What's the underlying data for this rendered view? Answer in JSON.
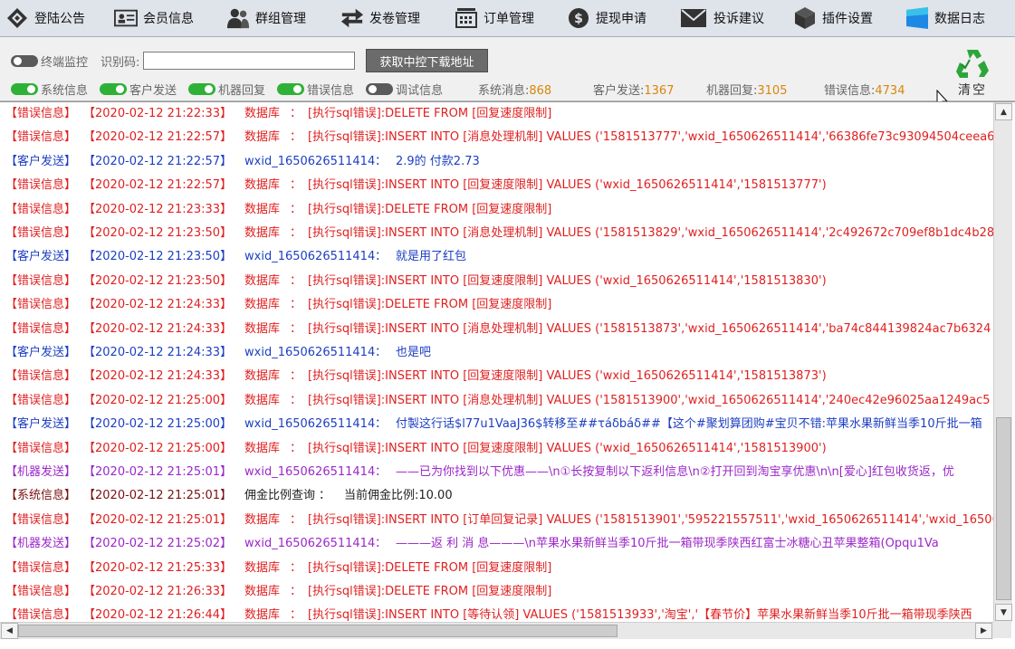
{
  "menu": [
    {
      "label": "登陆公告",
      "icon": "diamond-login-icon"
    },
    {
      "label": "会员信息",
      "icon": "member-card-icon"
    },
    {
      "label": "群组管理",
      "icon": "group-icon"
    },
    {
      "label": "发卷管理",
      "icon": "exchange-arrows-icon"
    },
    {
      "label": "订单管理",
      "icon": "cart-icon"
    },
    {
      "label": "提现申请",
      "icon": "dollar-coin-icon"
    },
    {
      "label": "投诉建议",
      "icon": "mail-icon"
    },
    {
      "label": "插件设置",
      "icon": "cube-icon"
    },
    {
      "label": "数据日志",
      "icon": "blue-window-icon"
    }
  ],
  "toolbar": {
    "terminal_monitor": "终端监控",
    "id_code_label": "识别码:",
    "id_code_value": "",
    "get_button": "获取中控下载地址",
    "clear_label": "清空",
    "toggles": [
      {
        "label": "系统信息",
        "on": true
      },
      {
        "label": "客户发送",
        "on": true
      },
      {
        "label": "机器回复",
        "on": true
      },
      {
        "label": "错误信息",
        "on": true
      },
      {
        "label": "调试信息",
        "on": false
      }
    ],
    "stats": [
      {
        "label": "系统消息:",
        "value": "868"
      },
      {
        "label": "客户发送:",
        "value": "1367"
      },
      {
        "label": "机器回复:",
        "value": "3105"
      },
      {
        "label": "错误信息:",
        "value": "4734"
      }
    ]
  },
  "logs": [
    {
      "type": "【错误信息】",
      "kind": "err",
      "time": "【2020-02-12 21:22:33】",
      "source": "数据库",
      "sep": "：",
      "msg": "[执行sql错误]:DELETE  FROM [回复速度限制]"
    },
    {
      "type": "【错误信息】",
      "kind": "err",
      "time": "【2020-02-12 21:22:57】",
      "source": "数据库",
      "sep": "：",
      "msg": "[执行sql错误]:INSERT INTO [消息处理机制] VALUES ('1581513777','wxid_1650626511414','66386fe73c93094504ceea6"
    },
    {
      "type": "【客户发送】",
      "kind": "cust",
      "time": "【2020-02-12 21:22:57】",
      "source": "wxid_1650626511414",
      "sep": "：",
      "msg": "2.9的  付款2.73"
    },
    {
      "type": "【错误信息】",
      "kind": "err",
      "time": "【2020-02-12 21:22:57】",
      "source": "数据库",
      "sep": "：",
      "msg": "[执行sql错误]:INSERT INTO [回复速度限制] VALUES ('wxid_1650626511414','1581513777')"
    },
    {
      "type": "【错误信息】",
      "kind": "err",
      "time": "【2020-02-12 21:23:33】",
      "source": "数据库",
      "sep": "：",
      "msg": "[执行sql错误]:DELETE  FROM [回复速度限制]"
    },
    {
      "type": "【错误信息】",
      "kind": "err",
      "time": "【2020-02-12 21:23:50】",
      "source": "数据库",
      "sep": "：",
      "msg": "[执行sql错误]:INSERT INTO [消息处理机制] VALUES ('1581513829','wxid_1650626511414','2c492672c709ef8b1dc4b28"
    },
    {
      "type": "【客户发送】",
      "kind": "cust",
      "time": "【2020-02-12 21:23:50】",
      "source": "wxid_1650626511414",
      "sep": "：",
      "msg": "就是用了红包"
    },
    {
      "type": "【错误信息】",
      "kind": "err",
      "time": "【2020-02-12 21:23:50】",
      "source": "数据库",
      "sep": "：",
      "msg": "[执行sql错误]:INSERT INTO [回复速度限制] VALUES ('wxid_1650626511414','1581513830')"
    },
    {
      "type": "【错误信息】",
      "kind": "err",
      "time": "【2020-02-12 21:24:33】",
      "source": "数据库",
      "sep": "：",
      "msg": "[执行sql错误]:DELETE  FROM [回复速度限制]"
    },
    {
      "type": "【错误信息】",
      "kind": "err",
      "time": "【2020-02-12 21:24:33】",
      "source": "数据库",
      "sep": "：",
      "msg": "[执行sql错误]:INSERT INTO [消息处理机制] VALUES ('1581513873','wxid_1650626511414','ba74c844139824ac7b6324"
    },
    {
      "type": "【客户发送】",
      "kind": "cust",
      "time": "【2020-02-12 21:24:33】",
      "source": "wxid_1650626511414",
      "sep": "：",
      "msg": "也是吧"
    },
    {
      "type": "【错误信息】",
      "kind": "err",
      "time": "【2020-02-12 21:24:33】",
      "source": "数据库",
      "sep": "：",
      "msg": "[执行sql错误]:INSERT INTO [回复速度限制] VALUES ('wxid_1650626511414','1581513873')"
    },
    {
      "type": "【错误信息】",
      "kind": "err",
      "time": "【2020-02-12 21:25:00】",
      "source": "数据库",
      "sep": "：",
      "msg": "[执行sql错误]:INSERT INTO [消息处理机制] VALUES ('1581513900','wxid_1650626511414','240ec42e96025aa1249ac5"
    },
    {
      "type": "【客户发送】",
      "kind": "cust",
      "time": "【2020-02-12 21:25:00】",
      "source": "wxid_1650626511414",
      "sep": "：",
      "msg": "付製这行话$l77u1VaaJ36$转移至##τáδbáδ##【这个#聚划算团购#宝贝不错:苹果水果新鲜当季10斤批一箱"
    },
    {
      "type": "【错误信息】",
      "kind": "err",
      "time": "【2020-02-12 21:25:00】",
      "source": "数据库",
      "sep": "：",
      "msg": "[执行sql错误]:INSERT INTO [回复速度限制] VALUES ('wxid_1650626511414','1581513900')"
    },
    {
      "type": "【机器发送】",
      "kind": "bot",
      "time": "【2020-02-12 21:25:01】",
      "source": "wxid_1650626511414",
      "sep": "：",
      "msg": "——已为你找到以下优惠——\\n①长按复制以下返利信息\\n②打开回到淘宝享优惠\\n\\n[爱心]红包收货返，优"
    },
    {
      "type": "【系统信息】",
      "kind": "sys",
      "time": "【2020-02-12 21:25:01】",
      "source": "佣金比例查询",
      "sep": "：",
      "msg": "当前佣金比例:10.00"
    },
    {
      "type": "【错误信息】",
      "kind": "err",
      "time": "【2020-02-12 21:25:01】",
      "source": "数据库",
      "sep": "：",
      "msg": "[执行sql错误]:INSERT INTO [订单回复记录] VALUES ('1581513901','595221557511','wxid_1650626511414','wxid_16506"
    },
    {
      "type": "【机器发送】",
      "kind": "bot",
      "time": "【2020-02-12 21:25:02】",
      "source": "wxid_1650626511414",
      "sep": "：",
      "msg": "———返 利 消 息———\\n苹果水果新鲜当季10斤批一箱带现季陕西红富士冰糖心丑苹果整箱(Opqu1Va"
    },
    {
      "type": "【错误信息】",
      "kind": "err",
      "time": "【2020-02-12 21:25:33】",
      "source": "数据库",
      "sep": "：",
      "msg": "[执行sql错误]:DELETE  FROM [回复速度限制]"
    },
    {
      "type": "【错误信息】",
      "kind": "err",
      "time": "【2020-02-12 21:26:33】",
      "source": "数据库",
      "sep": "：",
      "msg": "[执行sql错误]:DELETE  FROM [回复速度限制]"
    },
    {
      "type": "【错误信息】",
      "kind": "err",
      "time": "【2020-02-12 21:26:44】",
      "source": "数据库",
      "sep": "：",
      "msg": "[执行sql错误]:INSERT INTO [等待认领] VALUES ('1581513933','淘宝','【春节价】苹果水果新鲜当季10斤批一箱带现季陕西"
    }
  ]
}
